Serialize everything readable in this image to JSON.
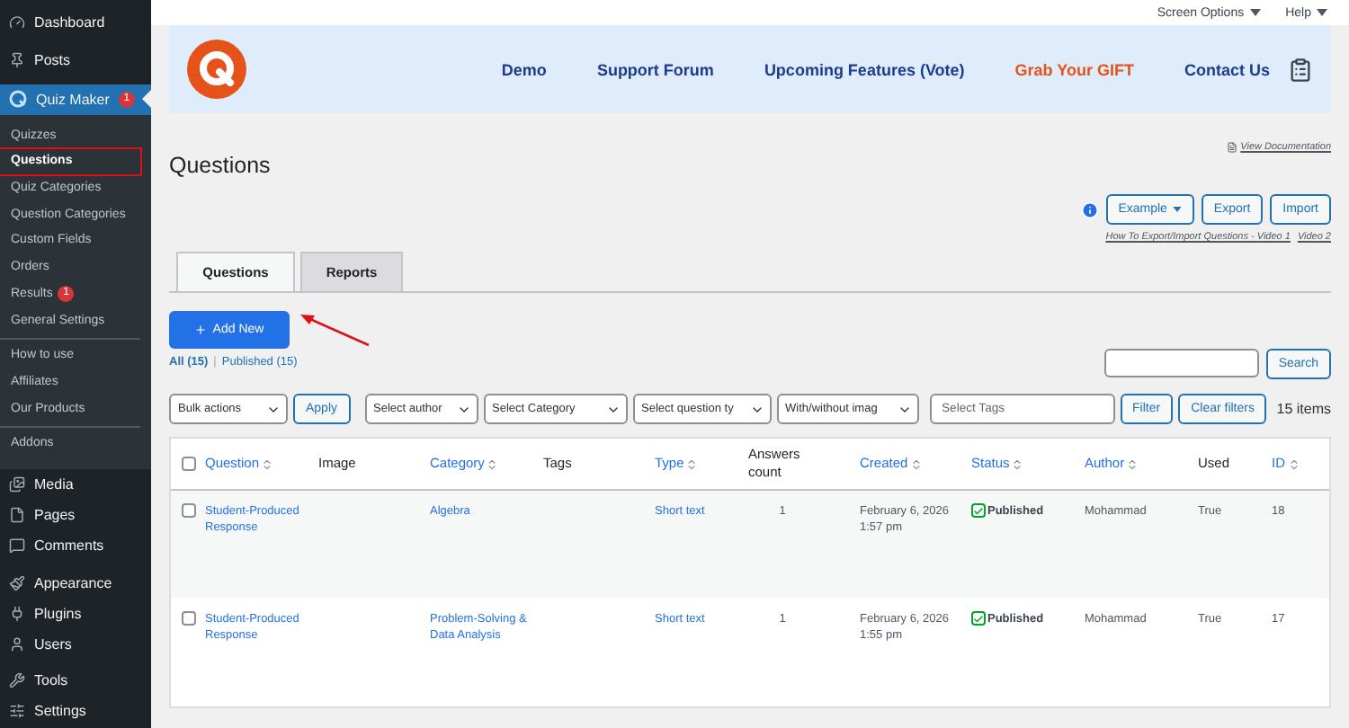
{
  "sidebar": {
    "items": [
      {
        "label": "Dashboard",
        "selected": false
      },
      {
        "label": "Posts",
        "selected": false
      },
      {
        "label": "Quiz Maker",
        "selected": true,
        "badge": "1",
        "expanded": true,
        "submenu_groups": [
          [
            {
              "label": "Quizzes",
              "selected": false
            },
            {
              "label": "Questions",
              "selected": true
            },
            {
              "label": "Quiz Categories",
              "selected": false
            },
            {
              "label": "Question Categories",
              "selected": false
            },
            {
              "label": "Custom Fields",
              "selected": false
            },
            {
              "label": "Orders",
              "selected": false
            },
            {
              "label": "Results",
              "selected": false,
              "badge": "1"
            },
            {
              "label": "General Settings",
              "selected": false
            }
          ],
          [
            {
              "label": "How to use",
              "selected": false
            },
            {
              "label": "Affiliates",
              "selected": false
            },
            {
              "label": "Our Products",
              "selected": false
            }
          ],
          [
            {
              "label": "Addons",
              "selected": false
            }
          ]
        ]
      },
      {
        "label": "Media",
        "selected": false
      },
      {
        "label": "Pages",
        "selected": false
      },
      {
        "label": "Comments",
        "selected": false
      },
      {
        "label": "Appearance",
        "selected": false
      },
      {
        "label": "Plugins",
        "selected": false
      },
      {
        "label": "Users",
        "selected": false
      },
      {
        "label": "Tools",
        "selected": false
      },
      {
        "label": "Settings",
        "selected": false
      }
    ]
  },
  "top_bar": {
    "links": [
      "Screen Options",
      "Help"
    ]
  },
  "banner": {
    "links": [
      {
        "label": "Demo",
        "kind": "normal"
      },
      {
        "label": "Support Forum",
        "kind": "normal"
      },
      {
        "label": "Upcoming Features (Vote)",
        "kind": "normal"
      },
      {
        "label": "Grab Your GIFT",
        "kind": "promo"
      },
      {
        "label": "Contact Us",
        "kind": "normal"
      }
    ]
  },
  "page": {
    "title": "Questions",
    "doc_link": "View Documentation",
    "actions": [
      "Example",
      "Export",
      "Import"
    ],
    "video_links": [
      "How To Export/Import Questions - Video 1",
      "Video 2"
    ]
  },
  "tabs": [
    {
      "label": "Questions",
      "selected": true
    },
    {
      "label": "Reports",
      "selected": false
    }
  ],
  "add_new": "Add New",
  "views_separator": "|",
  "views": [
    {
      "label": "All (15)",
      "selected": true
    },
    {
      "label": "Published (15)",
      "selected": false
    }
  ],
  "search": {
    "button": "Search"
  },
  "filters": {
    "selects": [
      {
        "label": "Bulk actions",
        "kind": "select"
      },
      {
        "label": "Apply",
        "kind": "button"
      },
      {
        "label": "Select author",
        "kind": "select"
      },
      {
        "label": "Select Category",
        "kind": "select"
      },
      {
        "label": "Select question ty",
        "kind": "select"
      },
      {
        "label": "With/without imag",
        "kind": "select"
      },
      {
        "label": "Select Tags",
        "kind": "input"
      },
      {
        "label": "Filter",
        "kind": "button"
      },
      {
        "label": "Clear filters",
        "kind": "button"
      }
    ],
    "count": "15 items"
  },
  "table": {
    "select_all_checked": false,
    "columns": [
      {
        "label": "Question",
        "sortable": true
      },
      {
        "label": "Image",
        "sortable": false
      },
      {
        "label": "Category",
        "sortable": true
      },
      {
        "label": "Tags",
        "sortable": false
      },
      {
        "label": "Type",
        "sortable": true
      },
      {
        "label": "Answers count",
        "sortable": false
      },
      {
        "label": "Created",
        "sortable": true
      },
      {
        "label": "Status",
        "sortable": true
      },
      {
        "label": "Author",
        "sortable": true
      },
      {
        "label": "Used",
        "sortable": false
      },
      {
        "label": "ID",
        "sortable": true
      }
    ],
    "rows": [
      {
        "checked": false,
        "question": "Student-Produced Response",
        "category": "Algebra",
        "type": "Short text",
        "answers": "1",
        "created": "February 6, 2026 1:57 pm",
        "status": "Published",
        "author": "Mohammad",
        "used": "True",
        "id": "18"
      },
      {
        "checked": false,
        "question": "Student-Produced Response",
        "category": "Problem-Solving & Data Analysis",
        "type": "Short text",
        "answers": "1",
        "created": "February 6, 2026 1:55 pm",
        "status": "Published",
        "author": "Mohammad",
        "used": "True",
        "id": "17"
      }
    ]
  }
}
